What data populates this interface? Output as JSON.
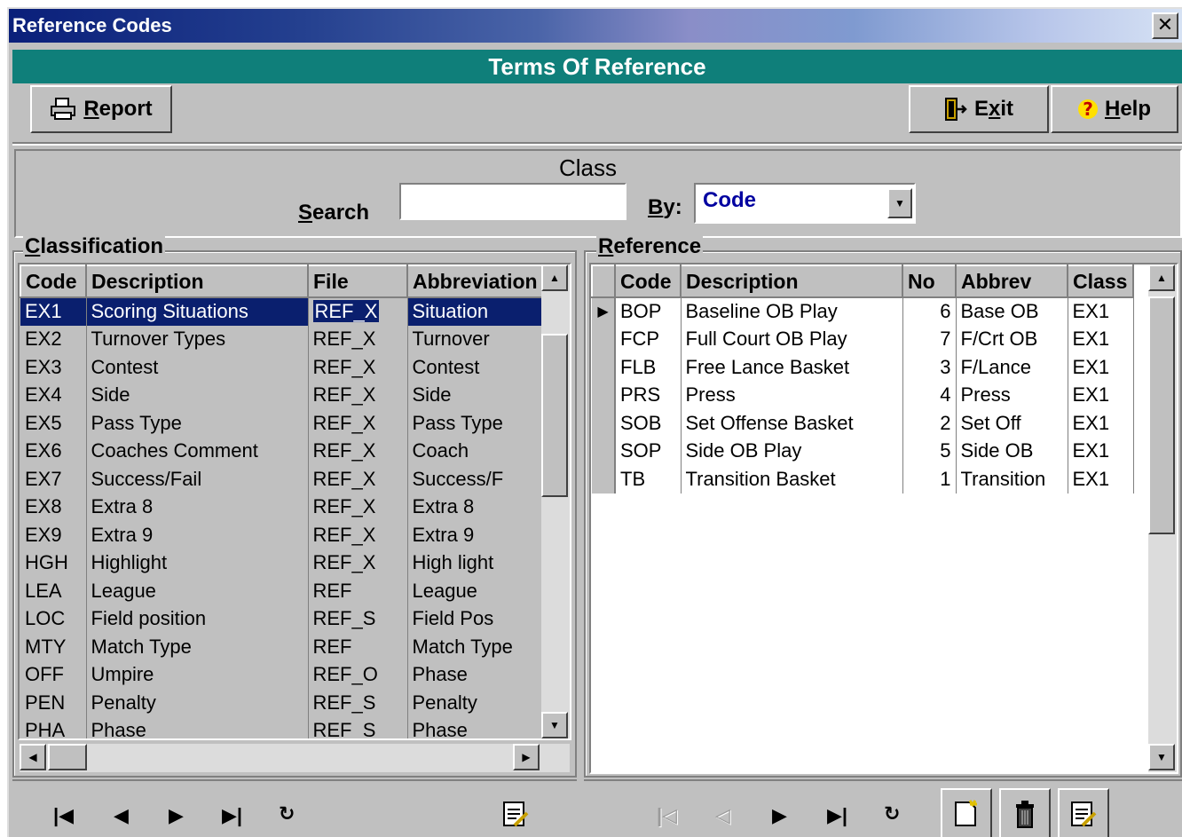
{
  "window": {
    "title": "Reference Codes",
    "close_glyph": "✕"
  },
  "banner": "Terms Of Reference",
  "toolbar": {
    "report_prefix": "",
    "report_ul": "R",
    "report_rest": "eport",
    "exit_pre": "E",
    "exit_ul": "x",
    "exit_post": "it",
    "help_ul": "H",
    "help_rest": "elp"
  },
  "class_panel": {
    "title": "Class",
    "search_ul": "S",
    "search_rest": "earch",
    "search_value": "",
    "by_ul": "B",
    "by_rest": "y:",
    "by_value": "Code"
  },
  "classification": {
    "label_ul": "C",
    "label_rest": "lassification",
    "columns": [
      "Code",
      "Description",
      "File",
      "Abbreviation"
    ],
    "rows": [
      [
        "EX1",
        "Scoring Situations",
        "REF_X",
        "Situation"
      ],
      [
        "EX2",
        "Turnover Types",
        "REF_X",
        "Turnover"
      ],
      [
        "EX3",
        "Contest",
        "REF_X",
        "Contest"
      ],
      [
        "EX4",
        "Side",
        "REF_X",
        "Side"
      ],
      [
        "EX5",
        "Pass Type",
        "REF_X",
        "Pass Type"
      ],
      [
        "EX6",
        "Coaches Comment",
        "REF_X",
        "Coach"
      ],
      [
        "EX7",
        "Success/Fail",
        "REF_X",
        "Success/F"
      ],
      [
        "EX8",
        "Extra 8",
        "REF_X",
        "Extra 8"
      ],
      [
        "EX9",
        "Extra 9",
        "REF_X",
        "Extra 9"
      ],
      [
        "HGH",
        "Highlight",
        "REF_X",
        "High light"
      ],
      [
        "LEA",
        "League",
        "REF",
        "League"
      ],
      [
        "LOC",
        "Field position",
        "REF_S",
        "Field Pos"
      ],
      [
        "MTY",
        "Match Type",
        "REF",
        "Match Type"
      ],
      [
        "OFF",
        "Umpire",
        "REF_O",
        "Phase"
      ],
      [
        "PEN",
        "Penalty",
        "REF_S",
        "Penalty"
      ],
      [
        "PHA",
        "Phase",
        "REF_S",
        "Phase"
      ]
    ]
  },
  "reference": {
    "label_ul": "R",
    "label_rest": "eference",
    "columns": [
      "Code",
      "Description",
      "No",
      "Abbrev",
      "Class"
    ],
    "rows": [
      [
        "BOP",
        "Baseline OB Play",
        "6",
        "Base OB",
        "EX1"
      ],
      [
        "FCP",
        "Full Court OB Play",
        "7",
        "F/Crt OB",
        "EX1"
      ],
      [
        "FLB",
        "Free Lance Basket",
        "3",
        "F/Lance",
        "EX1"
      ],
      [
        "PRS",
        "Press",
        "4",
        "Press",
        "EX1"
      ],
      [
        "SOB",
        "Set Offense Basket",
        "2",
        "Set Off",
        "EX1"
      ],
      [
        "SOP",
        "Side OB Play",
        "5",
        "Side OB",
        "EX1"
      ],
      [
        "TB",
        "Transition Basket",
        "1",
        "Transition",
        "EX1"
      ]
    ]
  },
  "colors": {
    "titlebar": "#0a1f7a",
    "banner": "#0f7f7a",
    "selection": "#0a1f6e",
    "face": "#c0c0c0"
  }
}
